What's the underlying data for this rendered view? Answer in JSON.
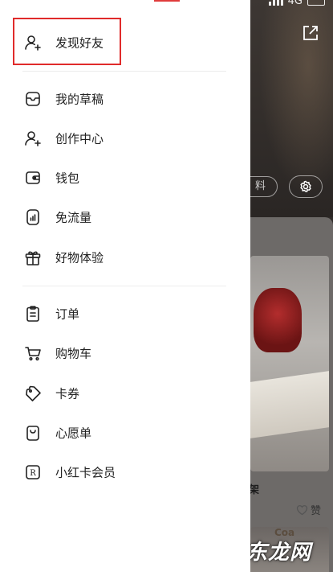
{
  "status_bar": {
    "network": "4G"
  },
  "drawer": {
    "top_item": {
      "label": "发现好友",
      "icon": "add-user-icon"
    },
    "section1": [
      {
        "label": "我的草稿",
        "icon": "inbox-icon"
      },
      {
        "label": "创作中心",
        "icon": "creator-icon"
      },
      {
        "label": "钱包",
        "icon": "wallet-icon"
      },
      {
        "label": "免流量",
        "icon": "data-free-icon"
      },
      {
        "label": "好物体验",
        "icon": "gift-icon"
      }
    ],
    "section2": [
      {
        "label": "订单",
        "icon": "clipboard-icon"
      },
      {
        "label": "购物车",
        "icon": "cart-icon"
      },
      {
        "label": "卡券",
        "icon": "coupon-icon"
      },
      {
        "label": "心愿单",
        "icon": "wishlist-icon"
      },
      {
        "label": "小红卡会员",
        "icon": "member-card-icon"
      }
    ],
    "accent_color": "#e02b2b"
  },
  "background": {
    "edit_profile_label": "料",
    "note_title": "架",
    "like_label": "赞",
    "next_card_text": "Coa"
  },
  "watermark": "广东龙网"
}
